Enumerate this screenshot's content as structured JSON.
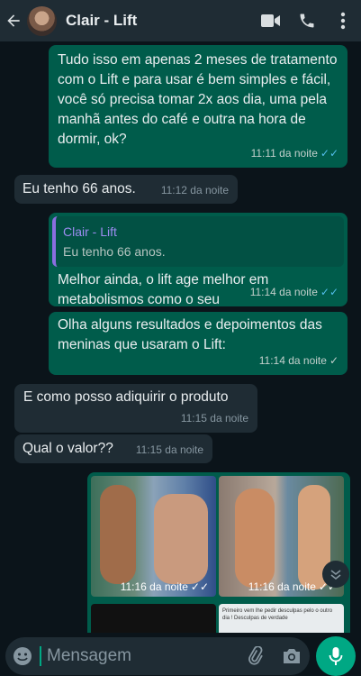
{
  "header": {
    "contact_name": "Clair - Lift"
  },
  "messages": [
    {
      "text": "Tudo isso em apenas 2 meses de tratamento com o Lift e para usar é bem simples e fácil, você só precisa tomar 2x aos dia, uma pela manhã antes do café e outra na hora de dormir, ok?",
      "time": "11:11 da noite"
    },
    {
      "text": "Eu tenho 66 anos.",
      "time": "11:12 da noite"
    },
    {
      "quote_name": "Clair - Lift",
      "quote_text": "Eu tenho 66 anos.",
      "text": "Melhor ainda, o lift age melhor em metabolismos como o seu",
      "time": "11:14 da noite"
    },
    {
      "text": "Olha alguns resultados e depoimentos das meninas que usaram o Lift:",
      "time": "11:14 da noite"
    },
    {
      "text": "E como posso adiquirir o produto",
      "time": "11:15 da noite"
    },
    {
      "text": "Qual o valor??",
      "time": "11:15 da noite"
    }
  ],
  "media": {
    "time1": "11:16 da noite",
    "time2": "11:16 da noite",
    "caption": "Primeiro vem lhe pedir desculpas pelo o outro dia ! Desculpas de verdade"
  },
  "composer": {
    "placeholder": "Mensagem"
  }
}
